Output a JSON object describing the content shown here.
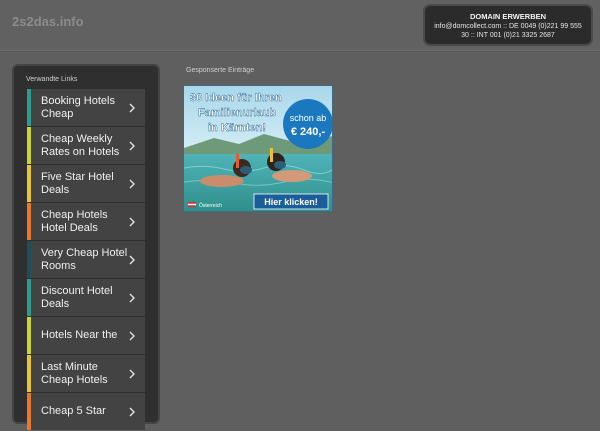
{
  "header": {
    "site_title": "2s2das.info",
    "domain_box": {
      "title": "DOMAIN ERWERBEN",
      "line1": "info@domcollect.com :: DE 0049 (0)221 99 555",
      "line2": "30 :: INT 001 (0)21 3325 2687"
    }
  },
  "sidebar": {
    "title": "Verwandte Links",
    "items": [
      {
        "label": "Booking Hotels Cheap",
        "color": "#2a9d8f"
      },
      {
        "label": "Cheap Weekly Rates on Hotels",
        "color": "#c9d43a"
      },
      {
        "label": "Five Star Hotel Deals",
        "color": "#e8c53a"
      },
      {
        "label": "Cheap Hotels Hotel Deals",
        "color": "#e8782a"
      },
      {
        "label": "Very Cheap Hotel Rooms",
        "color": "#1f4e5a"
      },
      {
        "label": "Discount Hotel Deals",
        "color": "#2a9d8f"
      },
      {
        "label": "Hotels Near the",
        "color": "#c9d43a"
      },
      {
        "label": "Last Minute Cheap Hotels",
        "color": "#e8c53a"
      },
      {
        "label": "Cheap 5 Star",
        "color": "#e8782a"
      }
    ]
  },
  "main": {
    "section_title": "Gesponserte Einträge",
    "ad": {
      "headline_line1": "30 Ideen für Ihren",
      "headline_line2": "Familienurlaub",
      "headline_line3": "in Kärnten!",
      "badge_line1": "schon ab",
      "badge_line2": "€ 240,-",
      "cta": "Hier klicken!",
      "brand": "Österreich"
    }
  }
}
